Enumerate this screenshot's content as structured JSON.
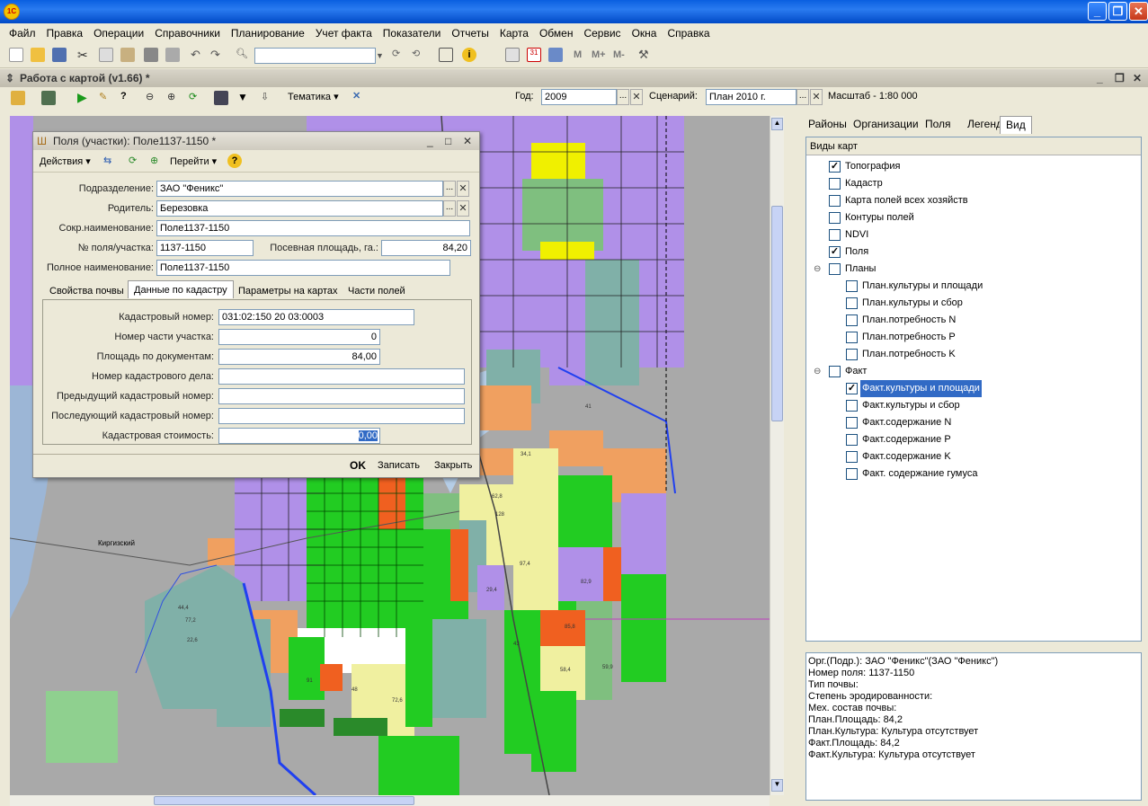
{
  "app": {
    "title": "Работа с картой (v1.66) *"
  },
  "menu": [
    "Файл",
    "Правка",
    "Операции",
    "Справочники",
    "Планирование",
    "Учет факта",
    "Показатели",
    "Отчеты",
    "Карта",
    "Обмен",
    "Сервис",
    "Окна",
    "Справка"
  ],
  "map_toolbar": {
    "thematics_label": "Тематика",
    "year_label": "Год:",
    "year_value": "2009",
    "scenario_label": "Сценарий:",
    "scenario_value": "План 2010 г.",
    "scale_label": "Масштаб - 1:80 000"
  },
  "map": {
    "place_label": "Киргизский",
    "field_labels": [
      "41",
      "34,1",
      "62,8",
      "97,4",
      "128",
      "82,9",
      "48",
      "72,6",
      "58,4",
      "59,9",
      "91",
      "43",
      "29,4",
      "85,8",
      "77,2",
      "44,4",
      "22,6"
    ]
  },
  "dialog": {
    "title": "Поля (участки): Поле1137-1150 *",
    "actions_label": "Действия",
    "goto_label": "Перейти",
    "subdivision_label": "Подразделение:",
    "subdivision_value": "ЗАО \"Феникс\"",
    "parent_label": "Родитель:",
    "parent_value": "Березовка",
    "short_name_label": "Сокр.наименование:",
    "short_name_value": "Поле1137-1150",
    "field_no_label": "№ поля/участка:",
    "field_no_value": "1137-1150",
    "sown_area_label": "Посевная площадь, га.:",
    "sown_area_value": "84,20",
    "full_name_label": "Полное наименование:",
    "full_name_value": "Поле1137-1150",
    "tabs": [
      "Свойства почвы",
      "Данные по кадастру",
      "Параметры на картах",
      "Части полей"
    ],
    "cadastre": {
      "number_label": "Кадастровый номер:",
      "number_value": "031:02:150 20 03:0003",
      "part_label": "Номер части участка:",
      "part_value": "0",
      "area_label": "Площадь по документам:",
      "area_value": "84,00",
      "case_label": "Номер кадастрового дела:",
      "case_value": "",
      "prev_label": "Предыдущий кадастровый номер:",
      "prev_value": "",
      "next_label": "Последующий кадастровый номер:",
      "next_value": "",
      "cost_label": "Кадастровая стоимость:",
      "cost_value": "0,00"
    },
    "ok_label": "OK",
    "save_label": "Записать",
    "close_label": "Закрыть"
  },
  "right_panel": {
    "tabs": [
      "Районы",
      "Организации",
      "Поля",
      "Легенда",
      "Вид"
    ],
    "tree_header": "Виды карт",
    "items": [
      {
        "label": "Топография",
        "checked": true
      },
      {
        "label": "Кадастр",
        "checked": false
      },
      {
        "label": "Карта полей всех хозяйств",
        "checked": false
      },
      {
        "label": "Контуры полей",
        "checked": false
      },
      {
        "label": "NDVI",
        "checked": false
      },
      {
        "label": "Поля",
        "checked": true
      },
      {
        "label": "Планы",
        "checked": false
      },
      {
        "label": "План.культуры и площади",
        "checked": false
      },
      {
        "label": "План.культуры и сбор",
        "checked": false
      },
      {
        "label": "План.потребность N",
        "checked": false
      },
      {
        "label": "План.потребность P",
        "checked": false
      },
      {
        "label": "План.потребность K",
        "checked": false
      },
      {
        "label": "Факт",
        "checked": false
      },
      {
        "label": "Факт.культуры и площади",
        "checked": true
      },
      {
        "label": "Факт.культуры и сбор",
        "checked": false
      },
      {
        "label": "Факт.содержание N",
        "checked": false
      },
      {
        "label": "Факт.содержание P",
        "checked": false
      },
      {
        "label": "Факт.содержание K",
        "checked": false
      },
      {
        "label": "Факт. содержание гумуса",
        "checked": false
      }
    ],
    "info_lines": [
      "Орг.(Подр.): ЗАО \"Феникс\"(ЗАО \"Феникс\")",
      "Номер поля: 1137-1150",
      "Тип почвы:",
      "Степень эродированности:",
      "Мех. состав почвы:",
      "План.Площадь: 84,2",
      "План.Культура: Культура отсутствует",
      "Факт.Площадь: 84,2",
      "Факт.Культура: Культура отсутствует"
    ]
  },
  "colors": {
    "selection": "#316ac5",
    "violet": "#b090e8",
    "green": "#22cc22",
    "orange": "#f0a060",
    "teal": "#80b0a8",
    "yellow": "#f0f000"
  }
}
